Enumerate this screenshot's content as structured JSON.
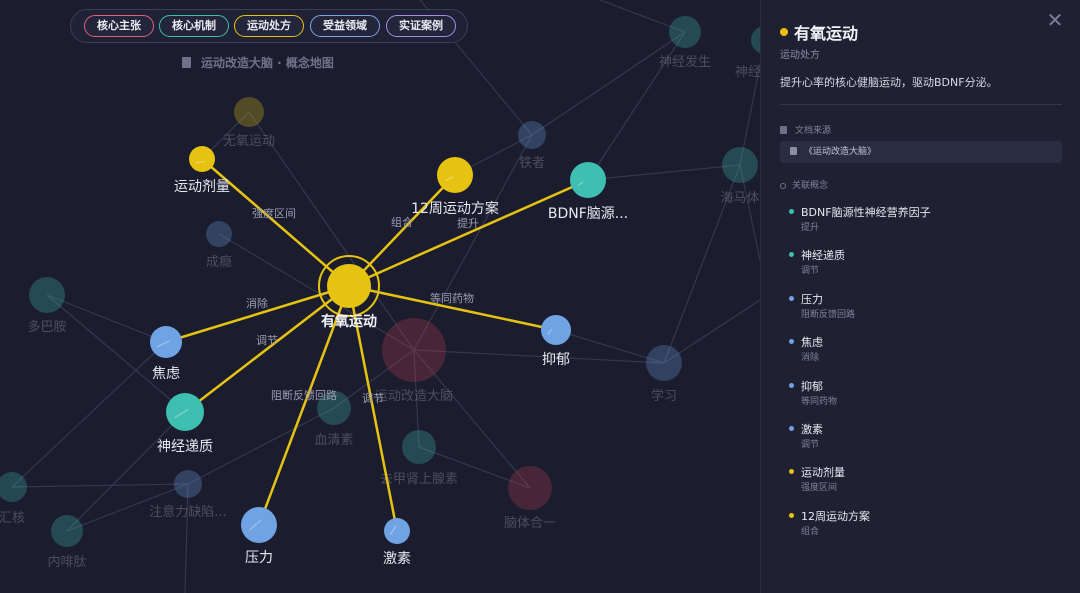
{
  "filters": [
    {
      "label": "核心主张",
      "color": "#e0607e"
    },
    {
      "label": "核心机制",
      "color": "#3fbfb1"
    },
    {
      "label": "运动处方",
      "color": "#e6c311"
    },
    {
      "label": "受益领域",
      "color": "#7aa6e8"
    },
    {
      "label": "实证案例",
      "color": "#a48ee8"
    }
  ],
  "graph_title": "运动改造大脑 · 概念地图",
  "colors": {
    "yellow": "#e6c311",
    "teal": "#3fbfb1",
    "blue": "#6fa3e4",
    "red": "#c0404e",
    "bg": "#1b1d2e"
  },
  "focus_node": {
    "label": "有氧运动"
  },
  "linked_nodes": [
    {
      "id": "dose",
      "label": "运动剂量",
      "color": "yellow",
      "edge": "强度区间"
    },
    {
      "id": "plan",
      "label": "12周运动方案",
      "color": "yellow",
      "edge": "组合"
    },
    {
      "id": "bdnf",
      "label": "BDNF脑源...",
      "color": "teal",
      "edge": "提升"
    },
    {
      "id": "anx",
      "label": "焦虑",
      "color": "blue",
      "edge": "消除"
    },
    {
      "id": "neuro",
      "label": "神经递质",
      "color": "teal",
      "edge": "调节"
    },
    {
      "id": "dep",
      "label": "抑郁",
      "color": "blue",
      "edge": "等同药物"
    },
    {
      "id": "stress",
      "label": "压力",
      "color": "blue",
      "edge": "阻断反馈回路"
    },
    {
      "id": "horm",
      "label": "激素",
      "color": "blue",
      "edge": "调节"
    }
  ],
  "background_nodes": [
    {
      "label": "无氧运动"
    },
    {
      "label": "成瘾"
    },
    {
      "label": "多巴胺"
    },
    {
      "label": "铁者"
    },
    {
      "label": "神经发生"
    },
    {
      "label": "神经"
    },
    {
      "label": "海马体"
    },
    {
      "label": "运动改造大脑"
    },
    {
      "label": "血清素"
    },
    {
      "label": "去甲肾上腺素"
    },
    {
      "label": "学习"
    },
    {
      "label": "注意力缺陷..."
    },
    {
      "label": "脑体合一"
    },
    {
      "label": "内啡肽"
    },
    {
      "label": "汇核"
    }
  ],
  "panel": {
    "title": "有氧运动",
    "title_color": "#e6c311",
    "category": "运动处方",
    "description": "提升心率的核心健脑运动，驱动BDNF分泌。",
    "source_label": "文档来源",
    "source": "《运动改造大脑》",
    "related_label": "关联概念",
    "related": [
      {
        "name": "BDNF脑源性神经营养因子",
        "rel": "提升",
        "color": "#3fbfb1"
      },
      {
        "name": "神经递质",
        "rel": "调节",
        "color": "#3fbfb1"
      },
      {
        "name": "压力",
        "rel": "阻断反馈回路",
        "color": "#6fa3e4"
      },
      {
        "name": "焦虑",
        "rel": "消除",
        "color": "#6fa3e4"
      },
      {
        "name": "抑郁",
        "rel": "等同药物",
        "color": "#6fa3e4"
      },
      {
        "name": "激素",
        "rel": "调节",
        "color": "#6fa3e4"
      },
      {
        "name": "运动剂量",
        "rel": "强度区间",
        "color": "#e6c311"
      },
      {
        "name": "12周运动方案",
        "rel": "组合",
        "color": "#e6c311"
      }
    ],
    "close_icon": "close-icon"
  }
}
